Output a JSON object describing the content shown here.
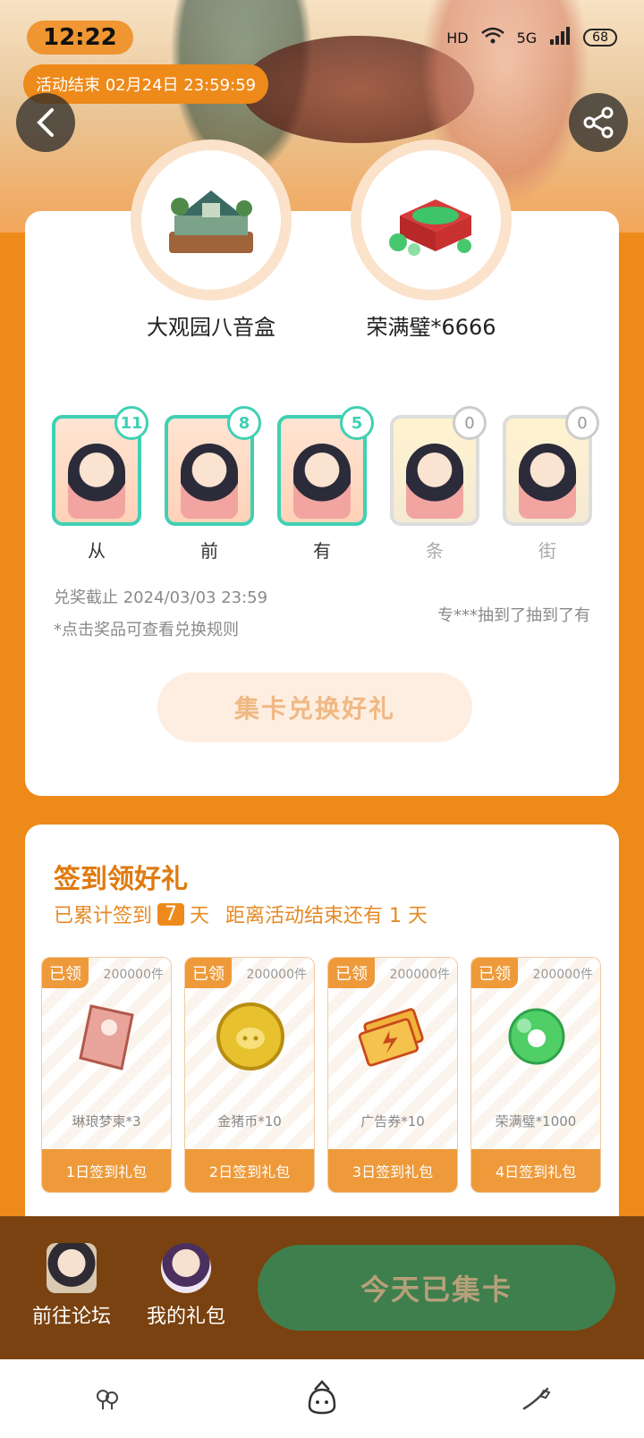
{
  "status_bar": {
    "time": "12:22",
    "network": "5G",
    "hd": "HD",
    "battery": "68"
  },
  "activity": {
    "end_label": "活动结束 02月24日 23:59:59"
  },
  "prizes": [
    {
      "name": "大观园八音盒",
      "icon": "music-box-icon"
    },
    {
      "name": "荣满璧*6666",
      "icon": "jade-gift-box-icon"
    }
  ],
  "cards": [
    {
      "label": "从",
      "count": "11"
    },
    {
      "label": "前",
      "count": "8"
    },
    {
      "label": "有",
      "count": "5"
    },
    {
      "label": "条",
      "count": "0"
    },
    {
      "label": "街",
      "count": "0"
    }
  ],
  "redeem": {
    "deadline": "兑奖截止 2024/03/03 23:59",
    "hint": "*点击奖品可查看兑换规则",
    "ticker": "专***抽到了抽到了有",
    "button": "集卡兑换好礼"
  },
  "signin": {
    "title": "签到领好礼",
    "prefix": "已累计签到",
    "days": "7",
    "suffix": "天",
    "remaining": "距离活动结束还有 1 天",
    "gifts": [
      {
        "status": "已领",
        "stock": "200000件",
        "name": "琳琅梦柬*3",
        "button": "1日签到礼包",
        "icon": "scroll-ticket-icon"
      },
      {
        "status": "已领",
        "stock": "200000件",
        "name": "金猪币*10",
        "button": "2日签到礼包",
        "icon": "gold-pig-coin-icon"
      },
      {
        "status": "已领",
        "stock": "200000件",
        "name": "广告券*10",
        "button": "3日签到礼包",
        "icon": "ad-coupon-icon"
      },
      {
        "status": "已领",
        "stock": "200000件",
        "name": "荣满璧*1000",
        "button": "4日签到礼包",
        "icon": "jade-ring-icon"
      }
    ]
  },
  "bottom_bar": {
    "forum": "前往论坛",
    "gifts": "我的礼包",
    "action": "今天已集卡"
  },
  "colors": {
    "accent": "#ee8a1a",
    "card_teal": "#3fd0b4",
    "action_green": "#3f7f4d",
    "bar_brown": "#7a4210"
  }
}
